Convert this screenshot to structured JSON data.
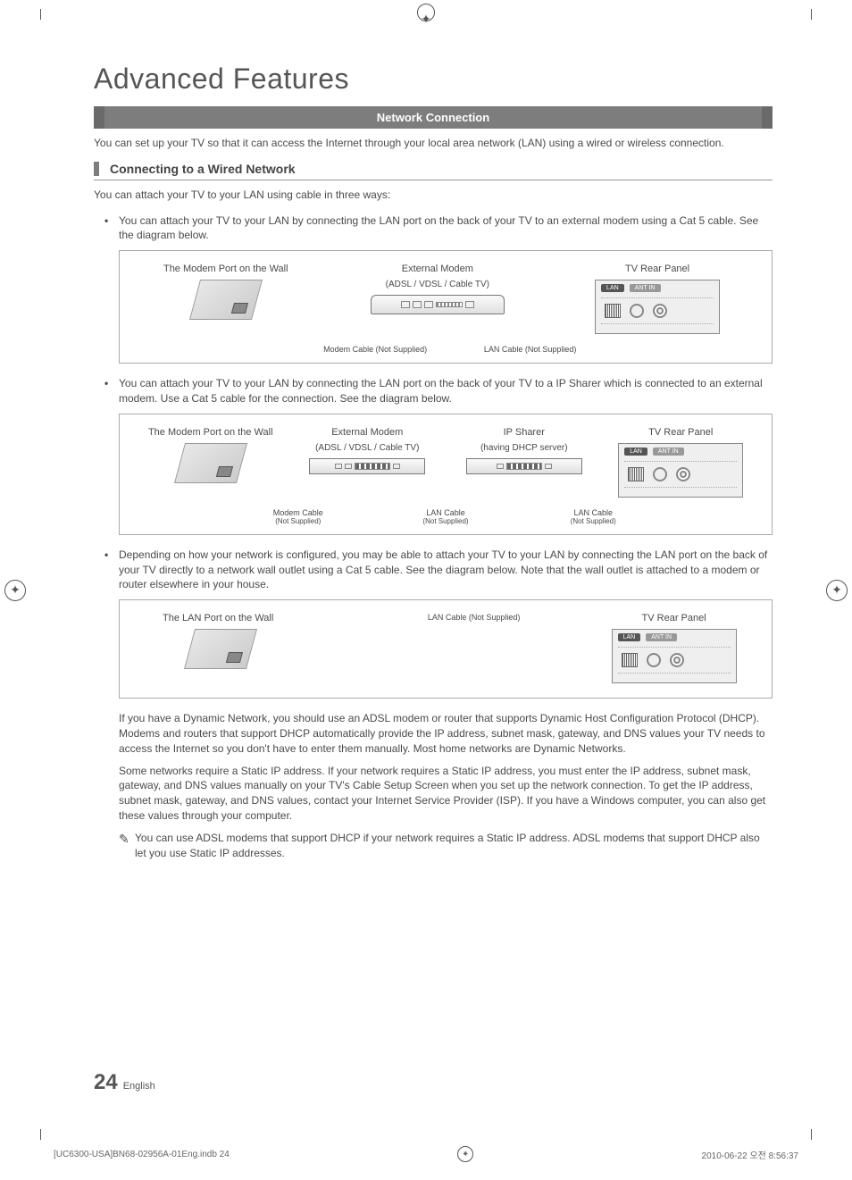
{
  "chapter_title": "Advanced Features",
  "section_bar": "Network Connection",
  "intro": "You can set up your TV so that it can access the Internet through your local area network (LAN) using a wired or wireless connection.",
  "sub_heading": "Connecting to a Wired Network",
  "lead_in": "You can attach your TV to your LAN using cable in three ways:",
  "bullets": {
    "b1": "You can attach your TV to your LAN by connecting the LAN port on the back of your TV to an external modem using a Cat 5 cable. See the diagram below.",
    "b2": "You can attach your TV to your LAN by connecting the LAN port on the back of your TV to a IP Sharer which is connected to an external modem. Use a Cat 5 cable for the connection. See the diagram below.",
    "b3": "Depending on how your network is configured, you may be able to attach your TV to your LAN by connecting the LAN port on the back of your TV directly to a network wall outlet using a Cat 5 cable. See the diagram below. Note that the wall outlet is attached to a modem or router elsewhere in your house."
  },
  "diagram_common": {
    "wall_label": "The Modem Port on the Wall",
    "lan_wall_label": "The LAN Port on the Wall",
    "ext_modem": "External Modem",
    "ext_modem_sub": "(ADSL / VDSL / Cable TV)",
    "ip_sharer": "IP Sharer",
    "ip_sharer_sub": "(having DHCP server)",
    "rear_panel": "TV Rear Panel",
    "modem_cable": "Modem Cable (Not Supplied)",
    "lan_cable": "LAN Cable (Not Supplied)",
    "modem_cable_short": "Modem Cable",
    "lan_cable_short": "LAN Cable",
    "not_supplied": "(Not Supplied)",
    "port_lan": "LAN",
    "port_ant": "ANT IN"
  },
  "paragraphs": {
    "p1": "If you have a Dynamic Network, you should use an ADSL modem or router that supports Dynamic Host Configuration Protocol (DHCP). Modems and routers that support DHCP automatically provide the IP address, subnet mask, gateway, and DNS values your TV needs to access the Internet so you don't have to enter them manually. Most home networks are Dynamic Networks.",
    "p2": "Some networks require a Static IP address. If your network requires a Static IP address, you must enter the IP address, subnet mask, gateway, and DNS values manually on your TV's Cable Setup Screen when you set up the network connection. To get the IP address, subnet mask, gateway, and DNS values, contact your Internet Service Provider (ISP). If you have a Windows computer, you can also get these values through your computer.",
    "note": "You can use ADSL modems that support DHCP if your network requires a Static IP address. ADSL modems that support DHCP also let you use Static IP addresses."
  },
  "page_number": "24",
  "page_lang": "English",
  "footer": {
    "left": "[UC6300-USA]BN68-02956A-01Eng.indb   24",
    "right": "2010-06-22   오전 8:56:37"
  }
}
